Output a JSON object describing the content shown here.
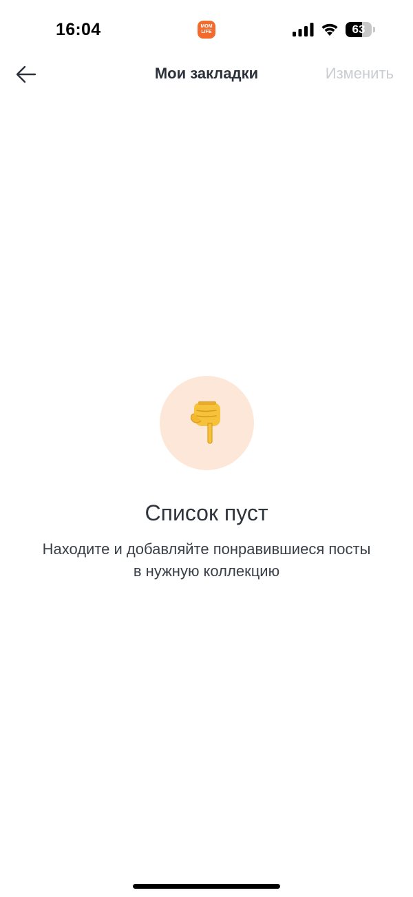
{
  "status_bar": {
    "time": "16:04",
    "app_logo_line1": "MOM",
    "app_logo_line2": "LIFE",
    "battery_level": 63,
    "battery_text": "63"
  },
  "nav": {
    "back_icon": "arrow-left-icon",
    "title": "Мои закладки",
    "edit_label": "Изменить"
  },
  "empty_state": {
    "icon": "pointing-down-hand-icon",
    "title": "Список пуст",
    "description": "Находите и добавляйте понравившиеся посты в нужную коллекцию"
  },
  "colors": {
    "accent_circle": "#fde7d8",
    "edit_disabled": "#c9ccd1",
    "logo": "#f26a2e"
  }
}
